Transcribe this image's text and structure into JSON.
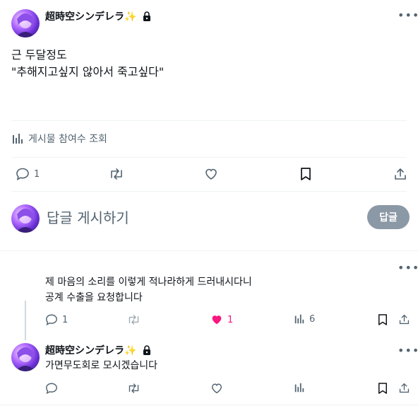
{
  "main_post": {
    "author_name": "超時空シンデレラ",
    "sparkle": "✨",
    "lines": [
      "근 두달정도",
      "\"추해지고싶지 않아서 죽고싶다\""
    ],
    "views_label": "게시물 참여수 조회",
    "reply_count": "1"
  },
  "compose": {
    "placeholder": "답글 게시하기",
    "submit_label": "답글"
  },
  "reply_1": {
    "lines": [
      "제 마음의 소리를 이렇게 적나라하게 드러내시다니",
      "공계 수출을 요청합니다"
    ],
    "reply_count": "1",
    "like_count": "1",
    "view_count": "6",
    "like_color": "#f91880"
  },
  "reply_2": {
    "author_name": "超時空シンデレラ",
    "sparkle": "✨",
    "text": "가면무도회로 모시겠습니다"
  }
}
